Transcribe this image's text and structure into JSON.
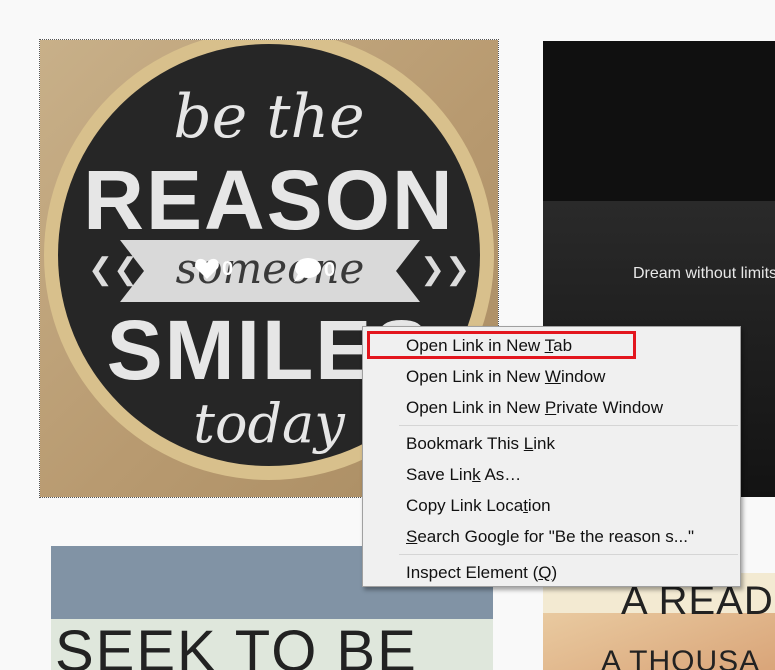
{
  "tiles": {
    "reason": {
      "art": {
        "line1": "be the",
        "line2": "REASON",
        "line3": "someone",
        "line4": "SMILES",
        "line5": "today"
      },
      "likes": "0",
      "comments": "0"
    },
    "dream": {
      "caption": "Dream without limits."
    },
    "seek": {
      "text": "SEEK TO BE"
    },
    "reader": {
      "line1": "A READE",
      "line2": "A THOUSA"
    }
  },
  "context_menu": {
    "items": [
      {
        "pre": "Open Link in New ",
        "key": "T",
        "post": "ab"
      },
      {
        "pre": "Open Link in New ",
        "key": "W",
        "post": "indow"
      },
      {
        "pre": "Open Link in New ",
        "key": "P",
        "post": "rivate Window"
      },
      {
        "pre": "Bookmark This ",
        "key": "L",
        "post": "ink"
      },
      {
        "pre": "Save Lin",
        "key": "k",
        "post": " As…"
      },
      {
        "pre": "Copy Link Loca",
        "key": "t",
        "post": "ion"
      },
      {
        "pre": "",
        "key": "S",
        "post": "earch Google for \"Be the reason s...\""
      },
      {
        "pre": "Inspect Element (",
        "key": "Q",
        "post": ")"
      }
    ]
  },
  "colors": {
    "highlight": "#e3161e",
    "menu_bg": "#f0f0f0"
  }
}
